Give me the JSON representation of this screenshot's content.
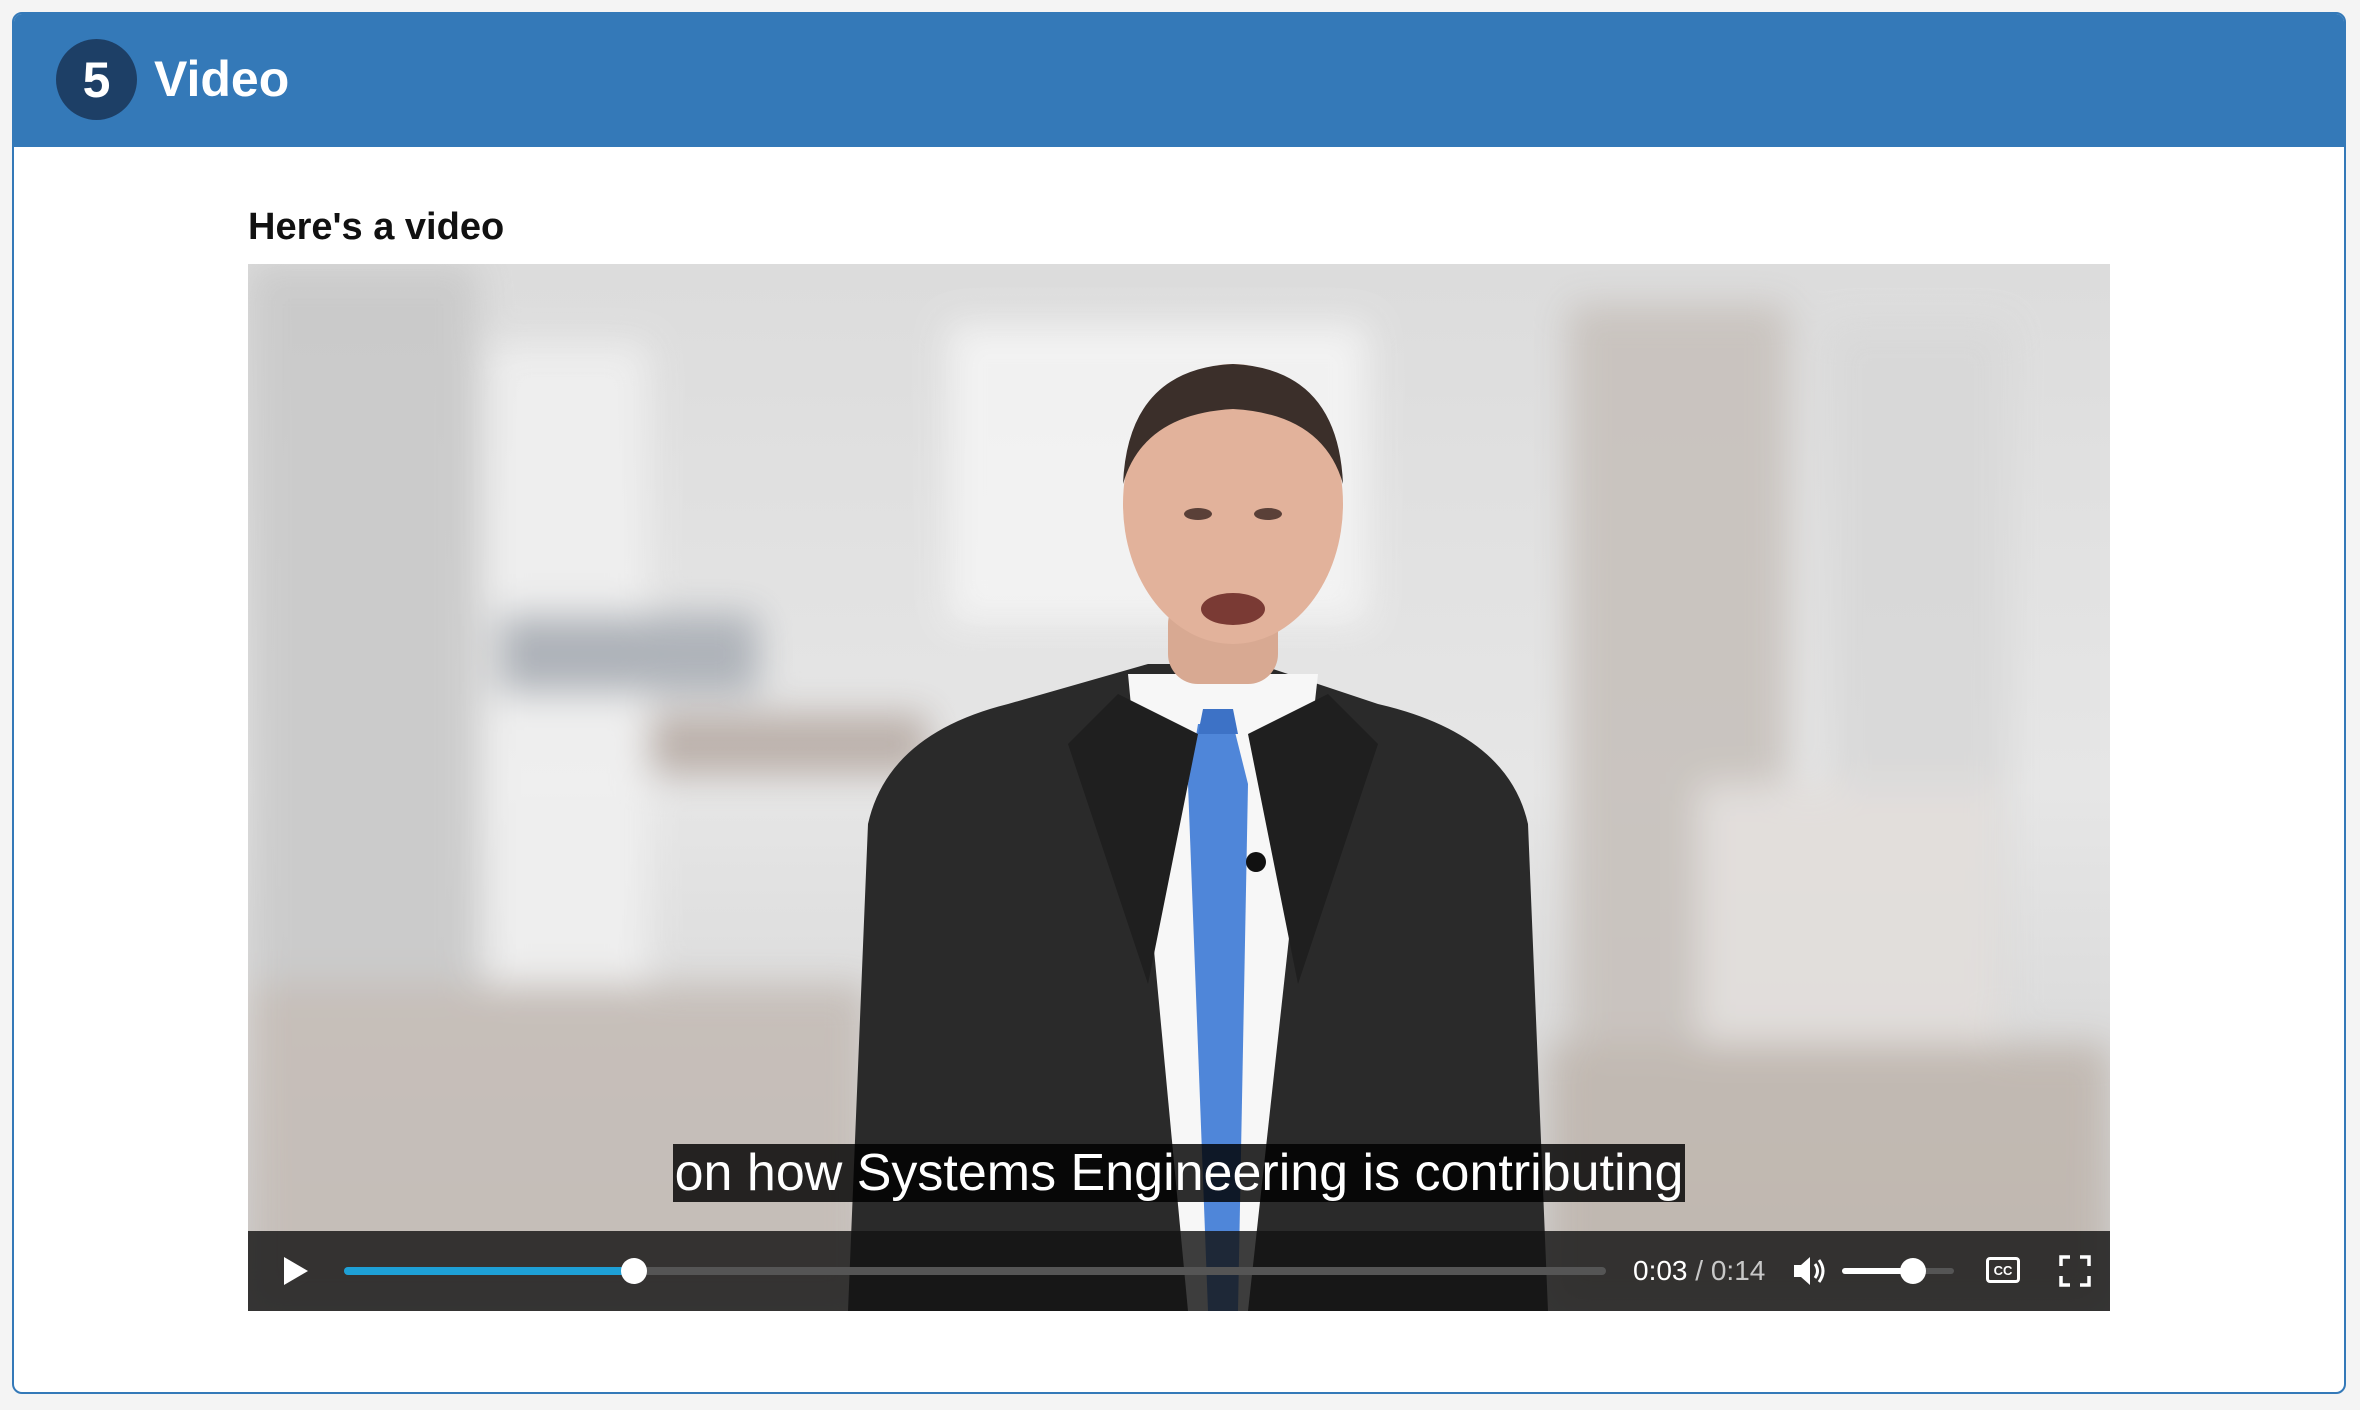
{
  "header": {
    "step_number": "5",
    "title": "Video",
    "background_color": "#3479b8",
    "badge_color": "#1d3f66"
  },
  "section": {
    "title": "Here's a video"
  },
  "video": {
    "caption": "on how Systems Engineering is contributing",
    "current_time": "0:03",
    "time_separator": "/",
    "duration": "0:14",
    "progress_fraction": 0.23,
    "volume_fraction": 0.63,
    "cc_label": "CC",
    "icons": {
      "play": "play-icon",
      "volume": "volume-icon",
      "captions": "closed-captions-icon",
      "fullscreen": "fullscreen-icon"
    },
    "accent_color": "#1ea0d6"
  }
}
